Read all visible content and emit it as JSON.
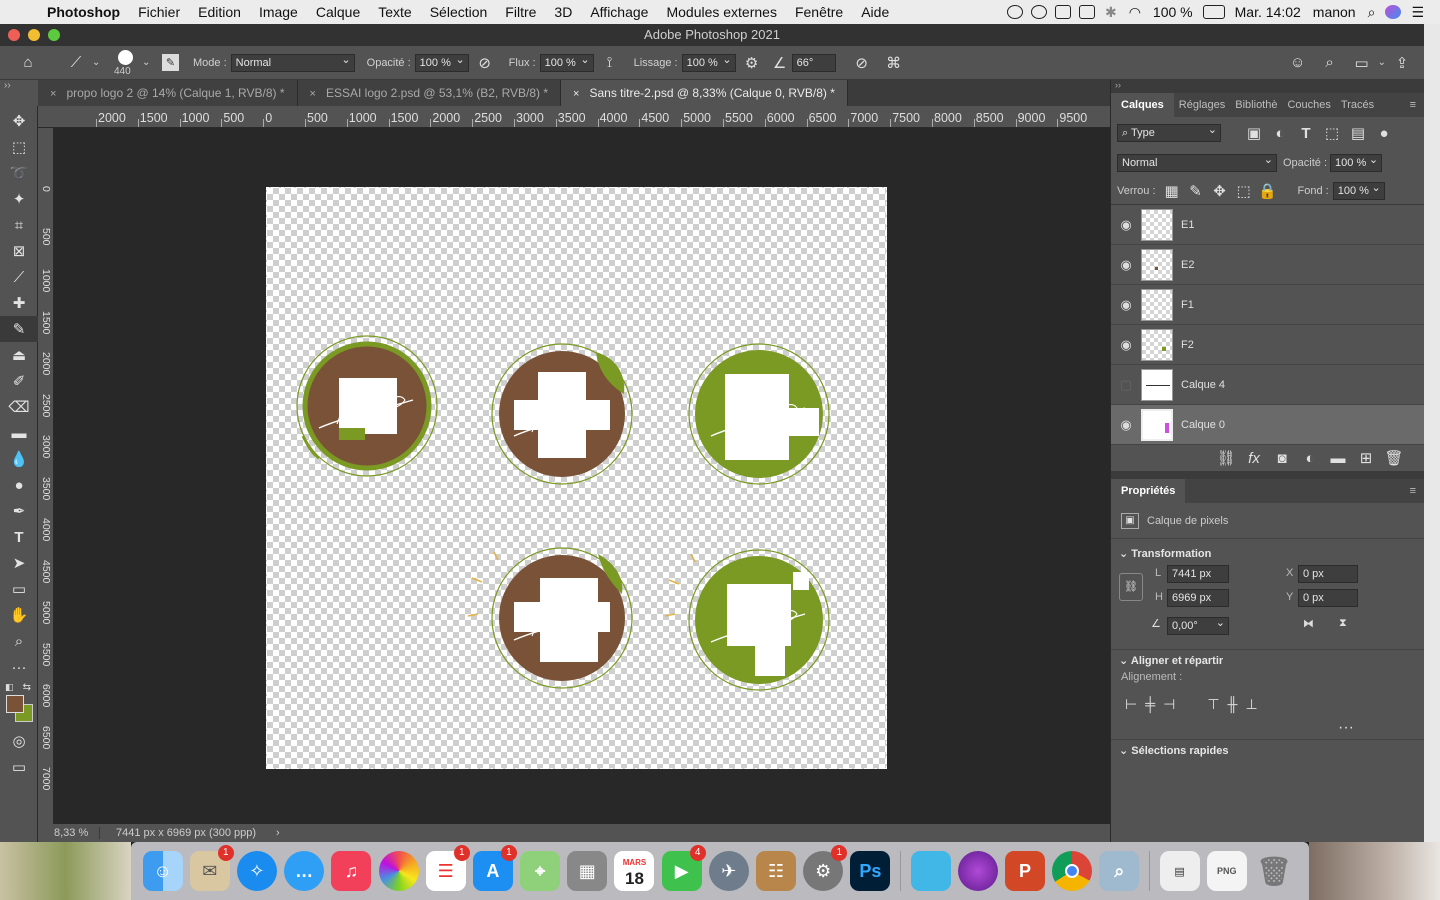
{
  "menubar": {
    "app": "Photoshop",
    "items": [
      "Fichier",
      "Edition",
      "Image",
      "Calque",
      "Texte",
      "Sélection",
      "Filtre",
      "3D",
      "Affichage",
      "Modules externes",
      "Fenêtre",
      "Aide"
    ],
    "battery": "100 %",
    "clock": "Mar. 14:02",
    "user": "manon"
  },
  "window": {
    "title": "Adobe Photoshop 2021"
  },
  "options": {
    "brush_size": "440",
    "mode_label": "Mode :",
    "mode_value": "Normal",
    "opacity_label": "Opacité :",
    "opacity_value": "100 %",
    "flux_label": "Flux :",
    "flux_value": "100 %",
    "lissage_label": "Lissage :",
    "lissage_value": "100 %",
    "angle_value": "66°"
  },
  "tabs": [
    {
      "label": "propo logo 2 @ 14% (Calque 1, RVB/8) *"
    },
    {
      "label": "ESSAI logo 2.psd @ 53,1% (B2, RVB/8) *"
    },
    {
      "label": "Sans titre-2.psd @ 8,33% (Calque 0, RVB/8) *"
    }
  ],
  "ruler_h": [
    "2000",
    "1500",
    "1000",
    "500",
    "0",
    "500",
    "1000",
    "1500",
    "2000",
    "2500",
    "3000",
    "3500",
    "4000",
    "4500",
    "5000",
    "5500",
    "6000",
    "6500",
    "7000",
    "7500",
    "8000",
    "8500",
    "9000",
    "9500"
  ],
  "ruler_v": [
    "0",
    "5 0 0",
    "1 0 0 0",
    "1 5 0 0",
    "2 0 0 0",
    "2 5 0 0",
    "3 0 0 0",
    "3 5 0 0",
    "4 0 0 0",
    "4 5 0 0",
    "5 0 0 0",
    "5 5 0 0",
    "6 0 0 0",
    "6 5 0 0",
    "7 0 0 0"
  ],
  "status": {
    "zoom": "8,33 %",
    "doc": "7441 px x 6969 px (300 ppp)"
  },
  "layers_panel": {
    "tabs": [
      "Calques",
      "Réglages",
      "Bibliothè",
      "Couches",
      "Tracés"
    ],
    "filter": "Type",
    "blend": "Normal",
    "opacity_label": "Opacité :",
    "opacity_value": "100 %",
    "lock_label": "Verrou :",
    "fill_label": "Fond :",
    "fill_value": "100 %",
    "layers": [
      {
        "name": "E1",
        "visible": true
      },
      {
        "name": "E2",
        "visible": true
      },
      {
        "name": "F1",
        "visible": true
      },
      {
        "name": "F2",
        "visible": true
      },
      {
        "name": "Calque 4",
        "visible": false
      },
      {
        "name": "Calque 0",
        "visible": true
      }
    ]
  },
  "properties": {
    "title": "Propriétés",
    "kind": "Calque de pixels",
    "transform_title": "Transformation",
    "w_label": "L",
    "w_value": "7441 px",
    "h_label": "H",
    "h_value": "6969 px",
    "x_label": "X",
    "x_value": "0 px",
    "y_label": "Y",
    "y_value": "0 px",
    "angle_value": "0,00°",
    "align_title": "Aligner et répartir",
    "align_label": "Alignement :",
    "quick_title": "Sélections rapides"
  },
  "dock": {
    "calendar_month": "MARS",
    "calendar_day": "18",
    "badges": {
      "mail": "1",
      "reminders": "1",
      "appstore": "1",
      "facetime": "4",
      "prefs": "1"
    },
    "ps_label": "Ps"
  },
  "colors": {
    "brown": "#7a5238",
    "green": "#7a9a23",
    "accent": "#1473e6"
  }
}
